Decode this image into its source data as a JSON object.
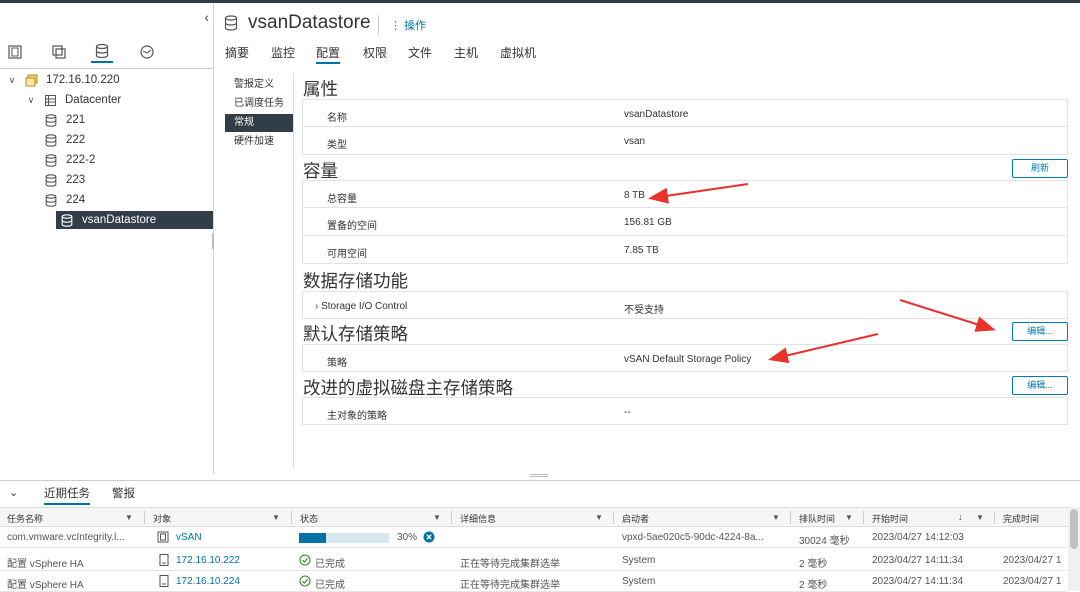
{
  "nav": {
    "tree": [
      {
        "label": "172.16.10.220",
        "type": "vcenter",
        "depth": 0,
        "expanded": true
      },
      {
        "label": "Datacenter",
        "type": "datacenter",
        "depth": 1,
        "expanded": true
      },
      {
        "label": "221",
        "type": "datastore",
        "depth": 2
      },
      {
        "label": "222",
        "type": "datastore",
        "depth": 2
      },
      {
        "label": "222-2",
        "type": "datastore",
        "depth": 2
      },
      {
        "label": "223",
        "type": "datastore",
        "depth": 2
      },
      {
        "label": "224",
        "type": "datastore",
        "depth": 2
      },
      {
        "label": "vsanDatastore",
        "type": "datastore",
        "depth": 2,
        "selected": true
      }
    ]
  },
  "header": {
    "title": "vsanDatastore",
    "actions_label": "操作"
  },
  "tabs": [
    "摘要",
    "监控",
    "配置",
    "权限",
    "文件",
    "主机",
    "虚拟机"
  ],
  "active_tab": "配置",
  "sub_menu": [
    "警报定义",
    "已调度任务",
    "常规",
    "硬件加速"
  ],
  "active_sub": "常规",
  "sections": {
    "properties": {
      "title": "属性",
      "rows": [
        {
          "key": "名称",
          "value": "vsanDatastore"
        },
        {
          "key": "类型",
          "value": "vsan"
        }
      ]
    },
    "capacity": {
      "title": "容量",
      "button": "刷新",
      "rows": [
        {
          "key": "总容量",
          "value": "8 TB"
        },
        {
          "key": "置备的空间",
          "value": "156.81 GB"
        },
        {
          "key": "可用空间",
          "value": "7.85 TB"
        }
      ]
    },
    "storage_features": {
      "title": "数据存储功能",
      "rows": [
        {
          "key": "Storage I/O Control",
          "value": "不受支持"
        }
      ]
    },
    "default_policy": {
      "title": "默认存储策略",
      "button": "编辑...",
      "rows": [
        {
          "key": "策略",
          "value": "vSAN Default Storage Policy"
        }
      ]
    },
    "improved_vdisk": {
      "title": "改进的虚拟磁盘主存储策略",
      "button": "编辑...",
      "rows": [
        {
          "key": "主对象的策略",
          "value": "--"
        }
      ]
    }
  },
  "bottom": {
    "tabs": [
      "近期任务",
      "警报"
    ],
    "active_tab": "近期任务",
    "columns": [
      "任务名称",
      "对象",
      "状态",
      "详细信息",
      "启动者",
      "排队时间",
      "开始时间",
      "完成时间"
    ],
    "rows": [
      {
        "task": "com.vmware.vcIntegrity.l...",
        "object": "vSAN",
        "object_icon": "cluster-icon",
        "status": "30%",
        "progress": 0.3,
        "details": "",
        "initiator": "vpxd-5ae020c5-90dc-4224-8a...",
        "queued": "30024 毫秒",
        "start": "2023/04/27 14:12:03",
        "end": ""
      },
      {
        "task": "配置 vSphere HA",
        "object": "172.16.10.222",
        "object_icon": "host-icon",
        "status": "已完成",
        "details": "正在等待完成集群选举",
        "initiator": "System",
        "queued": "2 毫秒",
        "start": "2023/04/27 14:11:34",
        "end": "2023/04/27 1"
      },
      {
        "task": "配置 vSphere HA",
        "object": "172.16.10.224",
        "object_icon": "host-icon",
        "status": "已完成",
        "details": "正在等待完成集群选举",
        "initiator": "System",
        "queued": "2 毫秒",
        "start": "2023/04/27 14:11:34",
        "end": "2023/04/27 1"
      }
    ]
  },
  "colors": {
    "accent": "#0072a3",
    "selected_bg": "#313d48",
    "annotation_arrow": "#e8322b"
  }
}
